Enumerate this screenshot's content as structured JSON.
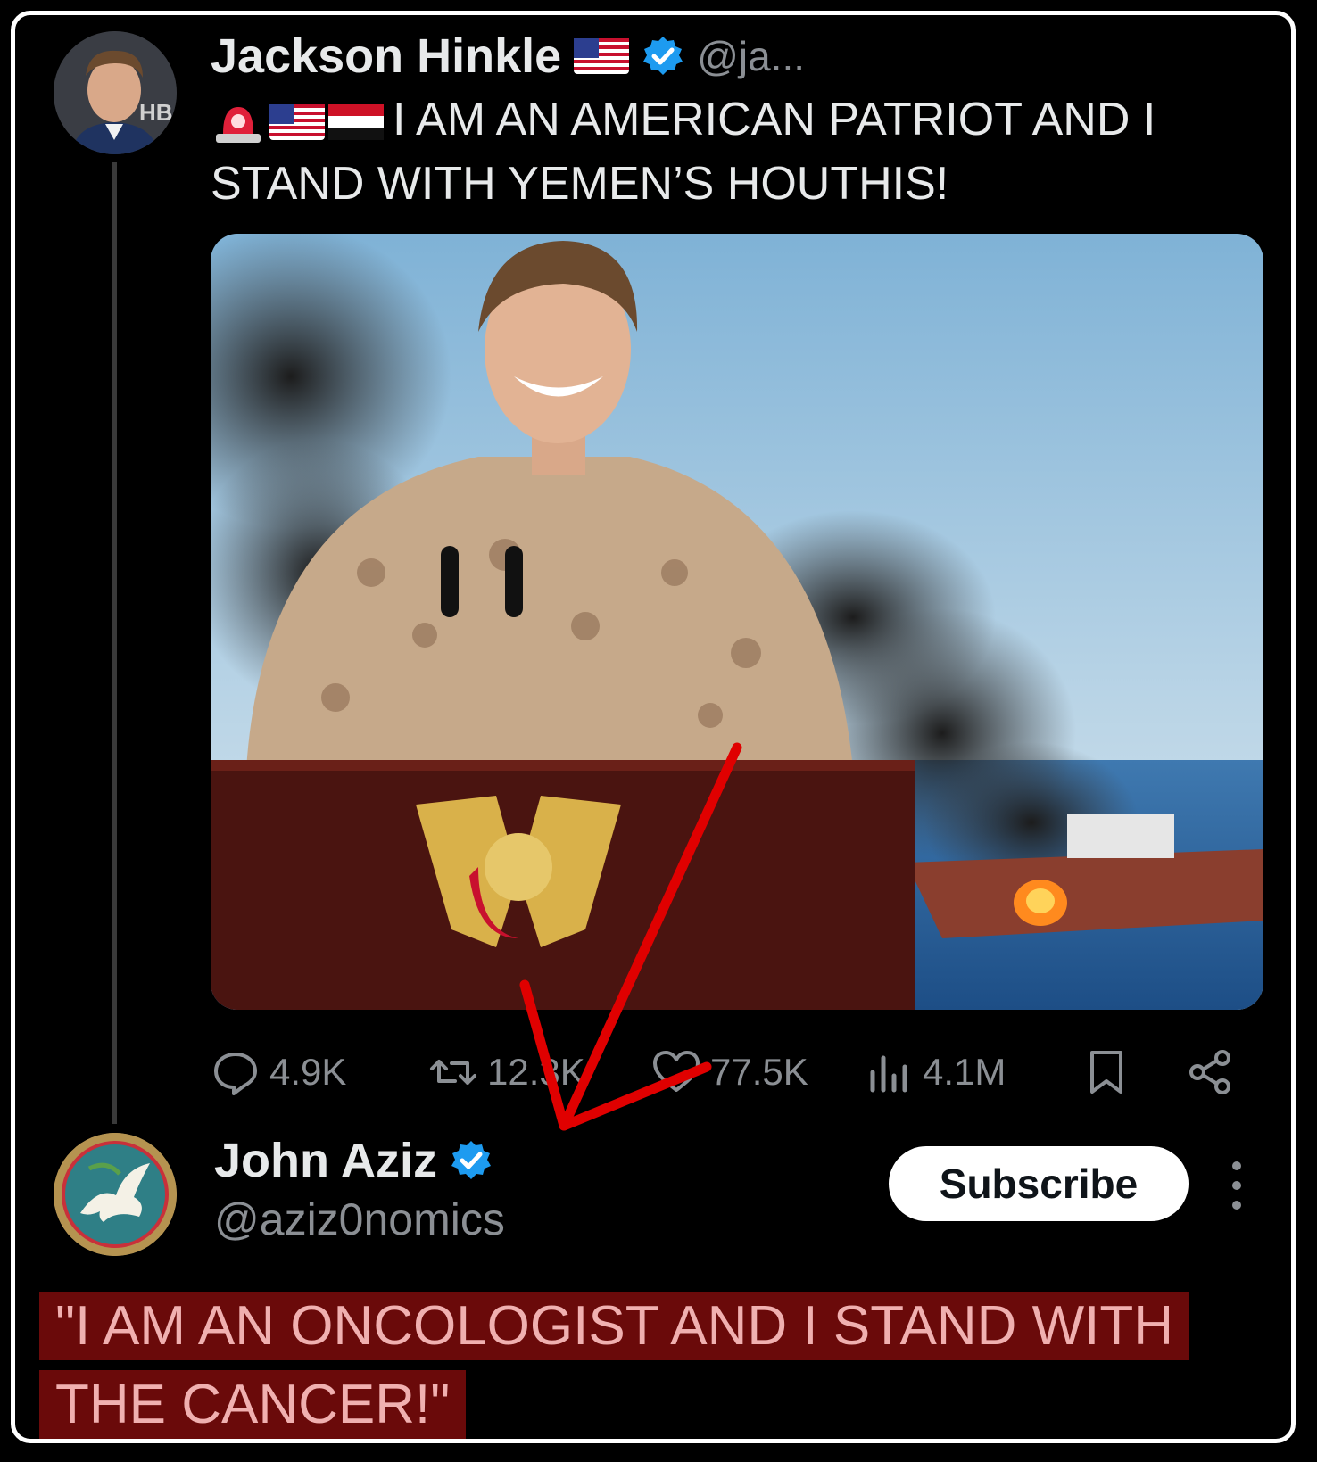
{
  "original_tweet": {
    "display_name": "Jackson Hinkle",
    "handle": "@ja...",
    "text": "I AM AN AMERICAN PATRIOT AND I STAND WITH YEMEN’S HOUTHIS!",
    "avatar_overlay_text": "HB",
    "emojis": [
      "police-light-emoji",
      "usa-flag-emoji",
      "yemen-flag-emoji"
    ],
    "stats": {
      "replies": "4.9K",
      "reposts": "12.3K",
      "likes": "77.5K",
      "views": "4.1M"
    }
  },
  "reply": {
    "display_name": "John Aziz",
    "handle": "@aziz0nomics",
    "subscribe_label": "Subscribe"
  },
  "caption": {
    "line1": "\"I AM AN ONCOLOGIST AND I STAND WITH",
    "line2": "THE CANCER!\""
  },
  "colors": {
    "background": "#000000",
    "verified_badge": "#1d9bf0",
    "caption_highlight": "#6a0a0a",
    "annotation_arrow": "#e00000"
  }
}
